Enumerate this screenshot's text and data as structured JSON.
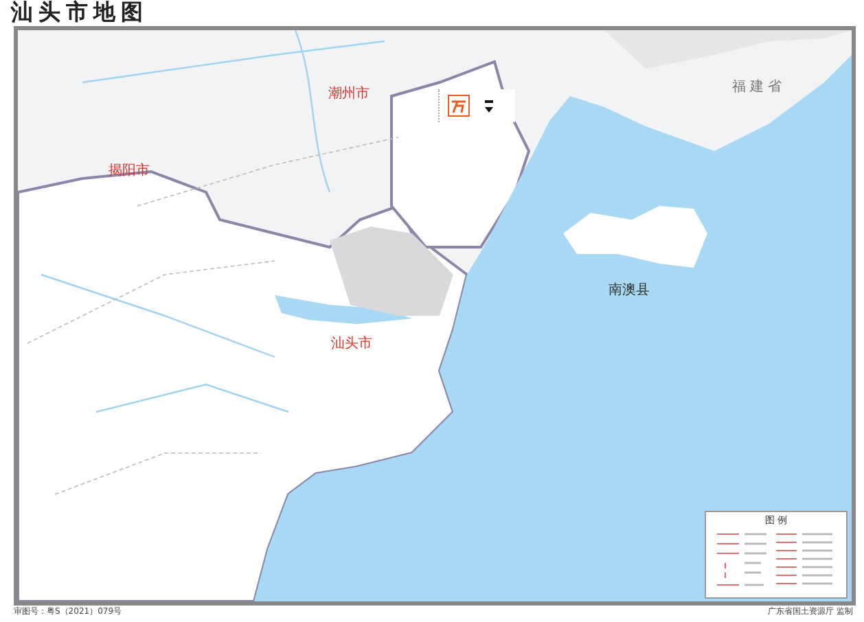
{
  "title": "汕头市地图",
  "map": {
    "labels": [
      {
        "text": "福建省",
        "kind": "province"
      },
      {
        "text": "潮州市",
        "kind": "city"
      },
      {
        "text": "揭阳市",
        "kind": "city"
      },
      {
        "text": "汕头市",
        "kind": "city"
      },
      {
        "text": "南澳县",
        "kind": "county"
      }
    ]
  },
  "legend": {
    "title": "图 例"
  },
  "footer": {
    "approval": "审图号：粤S（2021）079号",
    "publisher": "广东省国土资源厅 监制"
  }
}
